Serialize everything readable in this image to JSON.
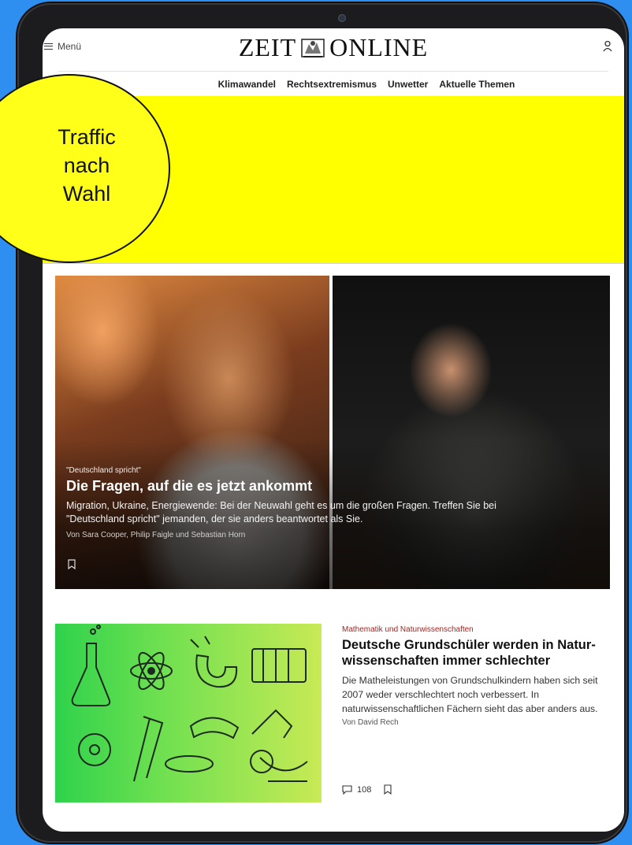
{
  "header": {
    "menu_label": "Menü",
    "logo_left": "ZEIT",
    "logo_right": "ONLINE"
  },
  "nav": {
    "items": [
      "Klimawandel",
      "Rechtsextremismus",
      "Unwetter",
      "Aktuelle Themen"
    ]
  },
  "callout": {
    "lines": [
      "Traffic",
      "nach",
      "Wahl"
    ]
  },
  "hero": {
    "kicker": "\"Deutschland spricht\"",
    "title": "Die Fragen, auf die es jetzt ankommt",
    "teaser": "Migration, Ukraine, Energiewende: Bei der Neuwahl geht es um die großen Fragen. Treffen Sie bei \"Deutschland spricht\" jemanden, der sie anders beantwortet als Sie.",
    "author": "Von Sara Cooper, Philip Faigle und Sebastian Horn"
  },
  "article2": {
    "kicker": "Mathematik und Naturwissenschaften",
    "title": "Deutsche Grundschüler werden in Natur­wissenschaften immer schlechter",
    "teaser": "Die Matheleistungen von Grundschulkindern haben sich seit 2007 weder verschlechtert noch verbessert. In naturwissenschaftlichen Fächern sieht das aber anders aus.",
    "author": "Von David Rech",
    "comment_count": "108"
  },
  "colors": {
    "background": "#2e8ff0",
    "highlight_yellow": "#ffff00",
    "kicker_red": "#a5231f"
  },
  "icons": [
    "menu-icon",
    "user-icon",
    "bookmark-icon",
    "comment-icon",
    "science-illustration"
  ]
}
